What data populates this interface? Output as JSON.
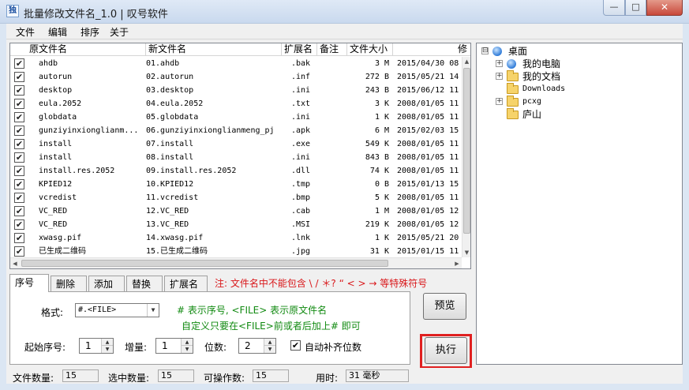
{
  "window": {
    "title": "批量修改文件名_1.0 | 叹号软件",
    "icon_glyph": "独",
    "min_glyph": "—",
    "max_glyph": "□",
    "close_glyph": "✕"
  },
  "menu": {
    "items": [
      "文件",
      "编辑",
      "排序",
      "关于"
    ]
  },
  "file_list": {
    "columns": [
      "原文件名",
      "新文件名",
      "扩展名",
      "备注",
      "文件大小",
      "修"
    ],
    "rows": [
      {
        "checked": true,
        "original": "ahdb",
        "new": "01.ahdb",
        "ext": ".bak",
        "size": "3 M",
        "date": "2015/04/30 08"
      },
      {
        "checked": true,
        "original": "autorun",
        "new": "02.autorun",
        "ext": ".inf",
        "size": "272 B",
        "date": "2015/05/21 14"
      },
      {
        "checked": true,
        "original": "desktop",
        "new": "03.desktop",
        "ext": ".ini",
        "size": "243 B",
        "date": "2015/06/12 11"
      },
      {
        "checked": true,
        "original": "eula.2052",
        "new": "04.eula.2052",
        "ext": ".txt",
        "size": "3 K",
        "date": "2008/01/05 11"
      },
      {
        "checked": true,
        "original": "globdata",
        "new": "05.globdata",
        "ext": ".ini",
        "size": "1 K",
        "date": "2008/01/05 11"
      },
      {
        "checked": true,
        "original": "gunziyinxionglianm...",
        "new": "06.gunziyinxionglianmeng_pj",
        "ext": ".apk",
        "size": "6 M",
        "date": "2015/02/03 15"
      },
      {
        "checked": true,
        "original": "install",
        "new": "07.install",
        "ext": ".exe",
        "size": "549 K",
        "date": "2008/01/05 11"
      },
      {
        "checked": true,
        "original": "install",
        "new": "08.install",
        "ext": ".ini",
        "size": "843 B",
        "date": "2008/01/05 11"
      },
      {
        "checked": true,
        "original": "install.res.2052",
        "new": "09.install.res.2052",
        "ext": ".dll",
        "size": "74 K",
        "date": "2008/01/05 11"
      },
      {
        "checked": true,
        "original": "KPIED12",
        "new": "10.KPIED12",
        "ext": ".tmp",
        "size": "0 B",
        "date": "2015/01/13 15"
      },
      {
        "checked": true,
        "original": "vcredist",
        "new": "11.vcredist",
        "ext": ".bmp",
        "size": "5 K",
        "date": "2008/01/05 11"
      },
      {
        "checked": true,
        "original": "VC_RED",
        "new": "12.VC_RED",
        "ext": ".cab",
        "size": "1 M",
        "date": "2008/01/05 12"
      },
      {
        "checked": true,
        "original": "VC_RED",
        "new": "13.VC_RED",
        "ext": ".MSI",
        "size": "219 K",
        "date": "2008/01/05 12"
      },
      {
        "checked": true,
        "original": "xwasg.pif",
        "new": "14.xwasg.pif",
        "ext": ".lnk",
        "size": "1 K",
        "date": "2015/05/21 20"
      },
      {
        "checked": true,
        "original": "已生成二维码",
        "new": "15.已生成二维码",
        "ext": ".jpg",
        "size": "31 K",
        "date": "2015/01/15 11"
      }
    ]
  },
  "tree": {
    "nodes": [
      {
        "label": "桌面",
        "icon": "desktop-icon",
        "expander": "⊟",
        "level": 0
      },
      {
        "label": "我的电脑",
        "icon": "computer-icon",
        "expander": "+",
        "level": 1
      },
      {
        "label": "我的文档",
        "icon": "folder-icon",
        "expander": "+",
        "level": 1
      },
      {
        "label": "Downloads",
        "icon": "folder-icon",
        "expander": "",
        "level": 1
      },
      {
        "label": "pcxg",
        "icon": "folder-icon",
        "expander": "+",
        "level": 1
      },
      {
        "label": "庐山",
        "icon": "folder-icon",
        "expander": "",
        "level": 1
      }
    ]
  },
  "tabs": {
    "items": [
      "序号",
      "删除",
      "添加",
      "替换",
      "扩展名"
    ],
    "active_index": 0
  },
  "warning": "注: 文件名中不能包含 \\ / ＊? “ < > → 等特殊符号",
  "serial_tab": {
    "format_label": "格式:",
    "format_value": "#.<FILE>",
    "hint_line1": "# 表示序号, <FILE> 表示原文件名",
    "hint_line2": "自定义只要在<FILE>前或者后加上# 即可",
    "start_label": "起始序号:",
    "start_value": "1",
    "increment_label": "增量:",
    "increment_value": "1",
    "digits_label": "位数:",
    "digits_value": "2",
    "auto_pad_label": "自动补齐位数",
    "auto_pad_checked": true
  },
  "buttons": {
    "preview": "预览",
    "execute": "执行"
  },
  "status": {
    "file_count_label": "文件数量:",
    "file_count": "15",
    "selected_label": "选中数量:",
    "selected": "15",
    "operable_label": "可操作数:",
    "operable": "15",
    "time_label": "用时:",
    "time_value": "31 毫秒"
  },
  "colors": {
    "warning": "#d9171a",
    "hint": "#118a11",
    "highlight_frame": "#e02020"
  }
}
